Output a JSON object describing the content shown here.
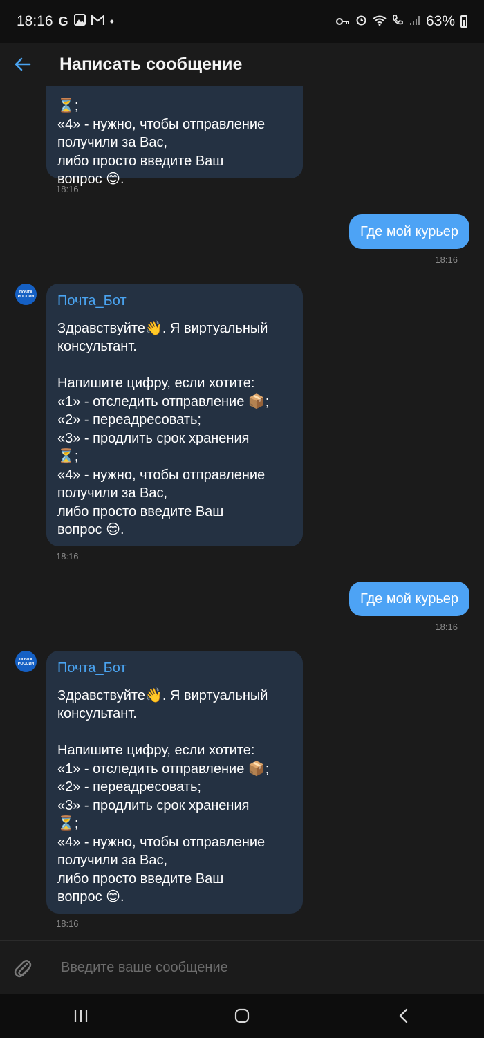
{
  "status_bar": {
    "time": "18:16",
    "app_icons": [
      "google-icon",
      "gallery-icon",
      "gmail-icon",
      "dot-icon"
    ],
    "right_icons": [
      "key-icon",
      "alarm-icon",
      "wifi-icon",
      "wifi-call-icon",
      "signal-icon"
    ],
    "battery": "63%"
  },
  "header": {
    "title": "Написать сообщение",
    "accent_color": "#4aa3f0"
  },
  "messages": {
    "top_partial": {
      "lines": [
        "⏳;",
        "«4» - нужно, чтобы отправление",
        "получили за Вас,",
        "либо просто введите Ваш",
        "вопрос 😊."
      ],
      "time": "18:16"
    },
    "out1": {
      "text": "Где мой курьер",
      "time": "18:16"
    },
    "bot1": {
      "sender": "Почта_Бот",
      "avatar_text": [
        "ПОЧТА",
        "РОССИИ"
      ],
      "lines": [
        "Здравствуйте👋. Я виртуальный",
        "консультант.",
        "",
        "Напишите цифру, если хотите:",
        "«1» - отследить отправление 📦;",
        "«2» - переадресовать;",
        "«3» - продлить срок хранения",
        "⏳;",
        "«4» - нужно, чтобы отправление",
        "получили за Вас,",
        "либо просто введите Ваш",
        "вопрос 😊."
      ],
      "time": "18:16"
    },
    "out2": {
      "text": "Где мой курьер",
      "time": "18:16"
    },
    "bot2": {
      "sender": "Почта_Бот",
      "avatar_text": [
        "ПОЧТА",
        "РОССИИ"
      ],
      "lines": [
        "Здравствуйте👋. Я виртуальный",
        "консультант.",
        "",
        "Напишите цифру, если хотите:",
        "«1» - отследить отправление 📦;",
        "«2» - переадресовать;",
        "«3» - продлить срок хранения",
        "⏳;",
        "«4» - нужно, чтобы отправление",
        "получили за Вас,",
        "либо просто введите Ваш",
        "вопрос 😊."
      ],
      "time": "18:16"
    }
  },
  "composer": {
    "placeholder": "Введите ваше сообщение"
  },
  "nav_bar": {
    "buttons": [
      "recent-apps-icon",
      "home-icon",
      "back-icon"
    ]
  }
}
